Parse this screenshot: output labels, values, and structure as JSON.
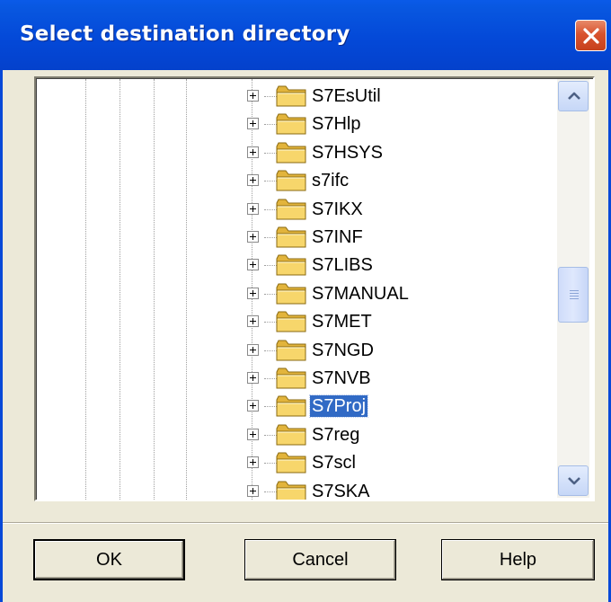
{
  "window": {
    "title": "Select destination directory",
    "close_icon": "close-icon"
  },
  "tree": {
    "selected_index": 11,
    "items": [
      {
        "label": "S7EsUtil"
      },
      {
        "label": "S7Hlp"
      },
      {
        "label": "S7HSYS"
      },
      {
        "label": "s7ifc"
      },
      {
        "label": "S7IKX"
      },
      {
        "label": "S7INF"
      },
      {
        "label": "S7LIBS"
      },
      {
        "label": "S7MANUAL"
      },
      {
        "label": "S7MET"
      },
      {
        "label": "S7NGD"
      },
      {
        "label": "S7NVB"
      },
      {
        "label": "S7Proj"
      },
      {
        "label": "S7reg"
      },
      {
        "label": "S7scl"
      },
      {
        "label": "S7SKA"
      }
    ],
    "icons": {
      "expand": "plus-expander-icon",
      "folder": "folder-icon"
    }
  },
  "scrollbar": {
    "up_icon": "arrow-up-icon",
    "down_icon": "arrow-down-icon"
  },
  "buttons": {
    "ok_label": "OK",
    "cancel_label": "Cancel",
    "help_label": "Help"
  },
  "colors": {
    "titlebar": "#0449d8",
    "selection": "#316ac5",
    "dialog_bg": "#ece9d8",
    "folder": "#f7d66b"
  }
}
